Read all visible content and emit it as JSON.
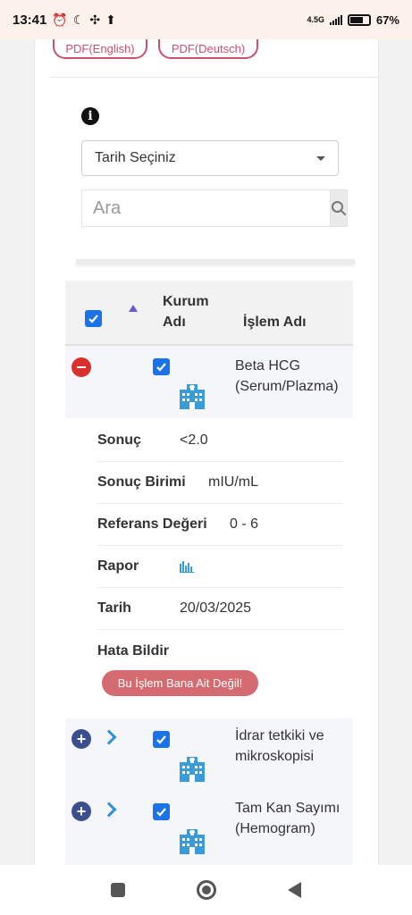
{
  "status_bar": {
    "time": "13:41",
    "network": "4.5G",
    "battery": "67%"
  },
  "pdf_buttons": {
    "english": "PDF(English)",
    "deutsch": "PDF(Deutsch)"
  },
  "filters": {
    "date_select": "Tarih Seçiniz",
    "search_placeholder": "Ara"
  },
  "table": {
    "header": {
      "institution": "Kurum Adı",
      "institution_line1": "Kurum",
      "institution_line2": "Adı",
      "procedure": "İşlem Adı"
    },
    "rows": [
      {
        "procedure_line1": "Beta HCG",
        "procedure_line2": "(Serum/Plazma)",
        "expanded": true,
        "details": {
          "result_label": "Sonuç",
          "result_value": "<2.0",
          "unit_label": "Sonuç Birimi",
          "unit_value": "mIU/mL",
          "reference_label": "Referans Değeri",
          "reference_value": "0 - 6",
          "report_label": "Rapor",
          "date_label": "Tarih",
          "date_value": "20/03/2025",
          "error_label": "Hata Bildir",
          "error_button": "Bu İşlem Bana Ait Değil!"
        }
      },
      {
        "procedure_line1": "İdrar tetkiki ve",
        "procedure_line2": "mikroskopisi",
        "expanded": false
      },
      {
        "procedure_line1": "Tam Kan Sayımı",
        "procedure_line2": "(Hemogram)",
        "expanded": false
      }
    ]
  },
  "colors": {
    "accent_pdf": "#c9506e",
    "checkbox": "#1a73e8",
    "collapse_button": "#d9302c",
    "expand_button": "#3b4f8f",
    "error_button": "#d36b71",
    "hospital_icon": "#3a9bd9"
  }
}
